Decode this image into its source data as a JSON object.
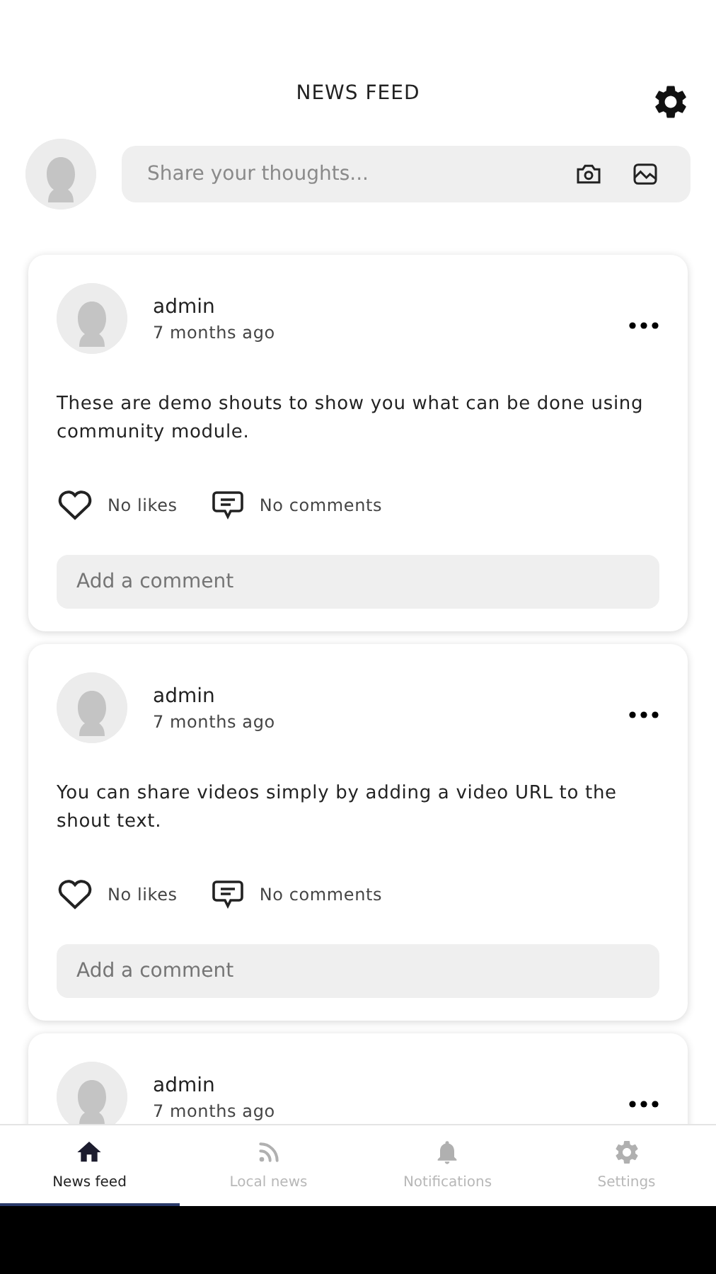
{
  "header": {
    "title": "NEWS FEED"
  },
  "composer": {
    "placeholder": "Share your thoughts..."
  },
  "posts": [
    {
      "author": "admin",
      "time": "7 months ago",
      "text": "These are demo shouts to show you what can be done using community module.",
      "likes": "No likes",
      "comments": "No comments",
      "comment_placeholder": "Add a comment"
    },
    {
      "author": "admin",
      "time": "7 months ago",
      "text": "You can share videos simply by adding a video URL to the shout text.",
      "likes": "No likes",
      "comments": "No comments",
      "comment_placeholder": "Add a comment"
    },
    {
      "author": "admin",
      "time": "7 months ago"
    }
  ],
  "tabs": [
    {
      "kind": "home",
      "label": "News feed",
      "selected": true
    },
    {
      "kind": "rss",
      "label": "Local news",
      "selected": false
    },
    {
      "kind": "bell",
      "label": "Notifications",
      "selected": false
    },
    {
      "kind": "gear",
      "label": "Settings",
      "selected": false
    }
  ]
}
